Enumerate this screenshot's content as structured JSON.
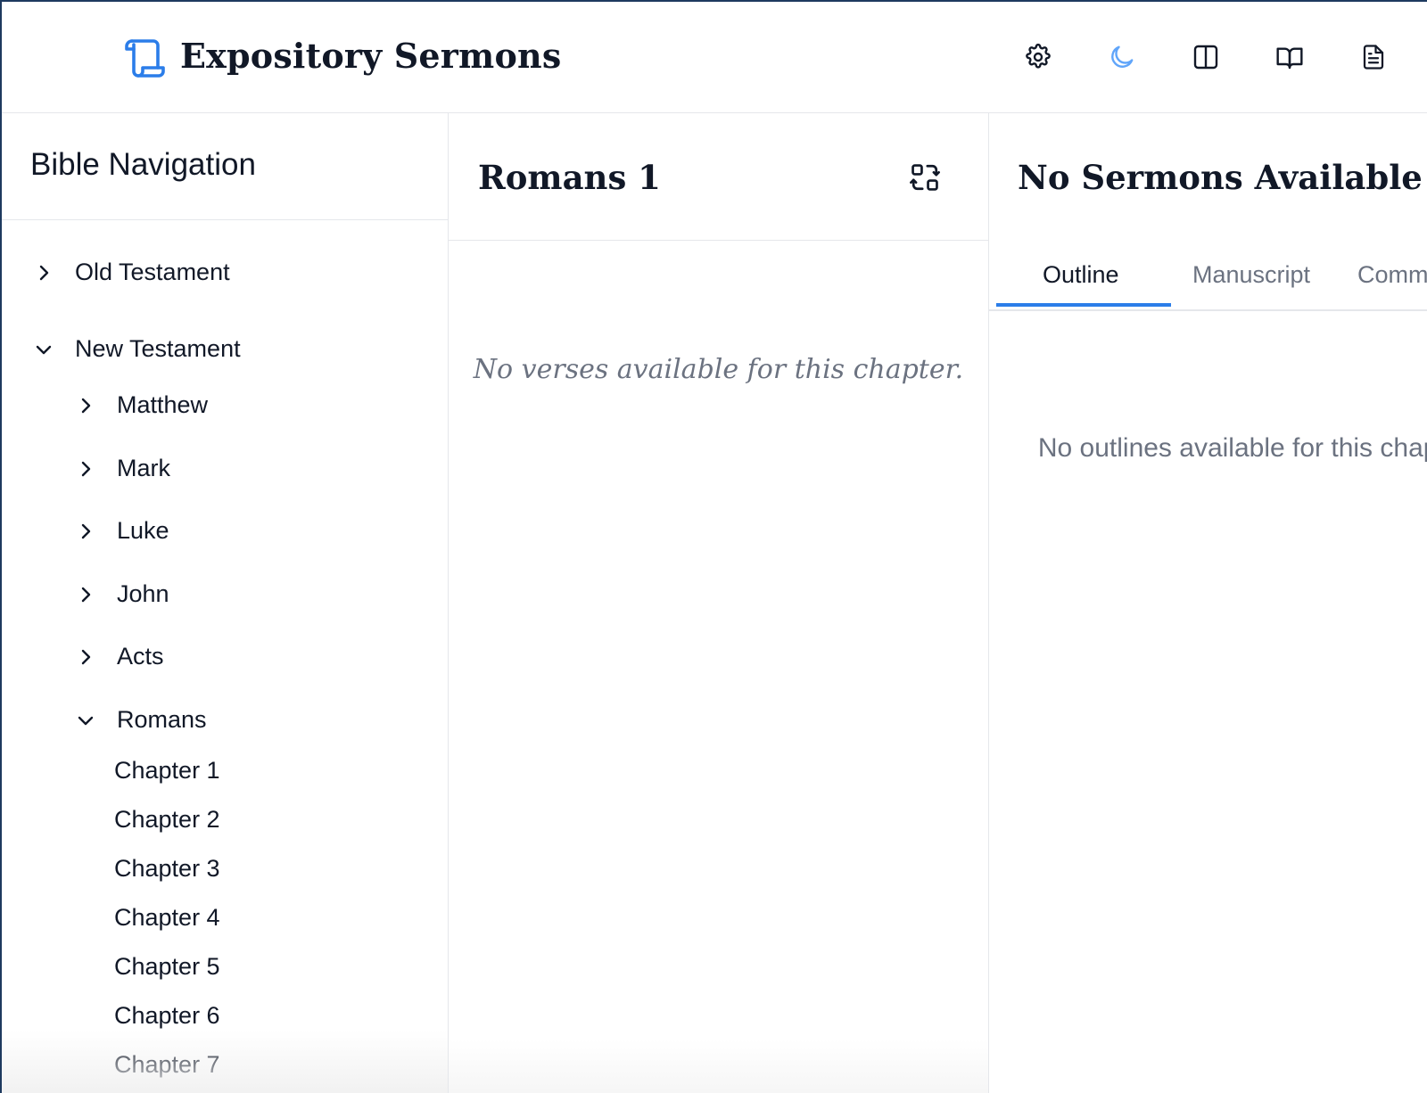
{
  "header": {
    "app_title": "Expository Sermons",
    "logo_icon": "scroll-icon",
    "icons": [
      "gear-icon",
      "moon-icon",
      "columns-icon",
      "book-open-icon",
      "document-icon"
    ],
    "accent_color": "#2b7de9"
  },
  "sidebar": {
    "title": "Bible Navigation",
    "testaments": [
      {
        "label": "Old Testament",
        "expanded": false
      },
      {
        "label": "New Testament",
        "expanded": true
      }
    ],
    "books": [
      {
        "label": "Matthew",
        "expanded": false
      },
      {
        "label": "Mark",
        "expanded": false
      },
      {
        "label": "Luke",
        "expanded": false
      },
      {
        "label": "John",
        "expanded": false
      },
      {
        "label": "Acts",
        "expanded": false
      },
      {
        "label": "Romans",
        "expanded": true
      }
    ],
    "chapters": [
      "Chapter 1",
      "Chapter 2",
      "Chapter 3",
      "Chapter 4",
      "Chapter 5",
      "Chapter 6",
      "Chapter 7"
    ]
  },
  "passage": {
    "title": "Romans 1",
    "empty_message": "No verses available for this chapter.",
    "swap_icon": "swap-layout-icon"
  },
  "sermons": {
    "title": "No Sermons Available",
    "tabs": [
      "Outline",
      "Manuscript",
      "Commentary"
    ],
    "active_tab": "Outline",
    "empty_message": "No outlines available for this chapter."
  }
}
